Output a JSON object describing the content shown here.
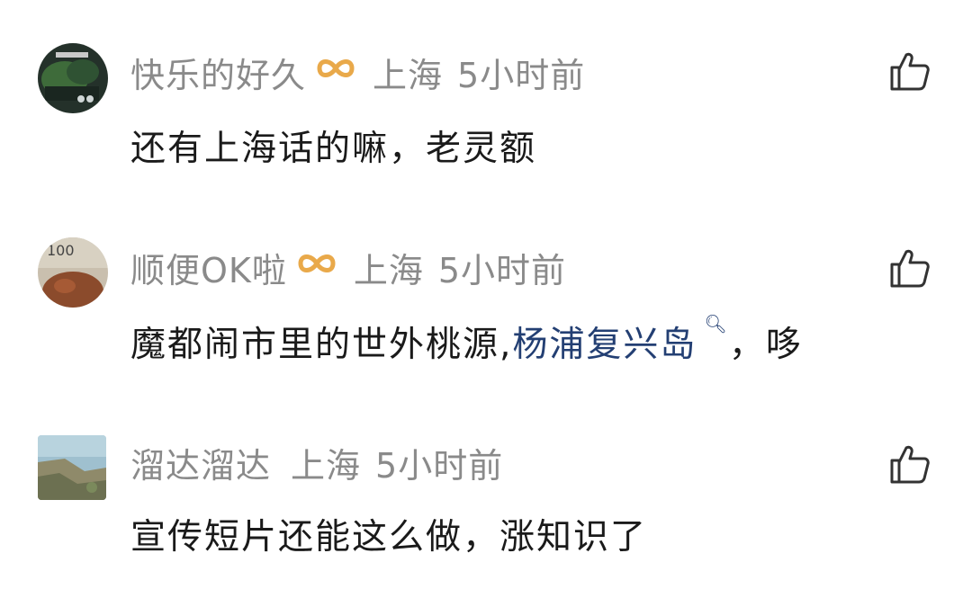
{
  "comments": [
    {
      "username": "快乐的好久",
      "has_badge": true,
      "location": "上海",
      "time": "5小时前",
      "text": "还有上海话的嘛，老灵额"
    },
    {
      "username": "顺便OK啦",
      "has_badge": true,
      "location": "上海",
      "time": "5小时前",
      "text_before": "魔都闹市里的世外桃源,",
      "link_text": "杨浦复兴岛",
      "text_after": "，哆"
    },
    {
      "username": "溜达溜达",
      "has_badge": false,
      "location": "上海",
      "time": "5小时前",
      "text": "宣传短片还能这么做，涨知识了"
    }
  ],
  "icons": {
    "badge": "infinity-badge-icon",
    "like": "thumbs-up-icon",
    "search": "search-icon"
  },
  "colors": {
    "meta_gray": "#8a8a8a",
    "text_dark": "#1a1a1a",
    "link_blue": "#233f73",
    "badge_orange": "#e9a94a"
  }
}
